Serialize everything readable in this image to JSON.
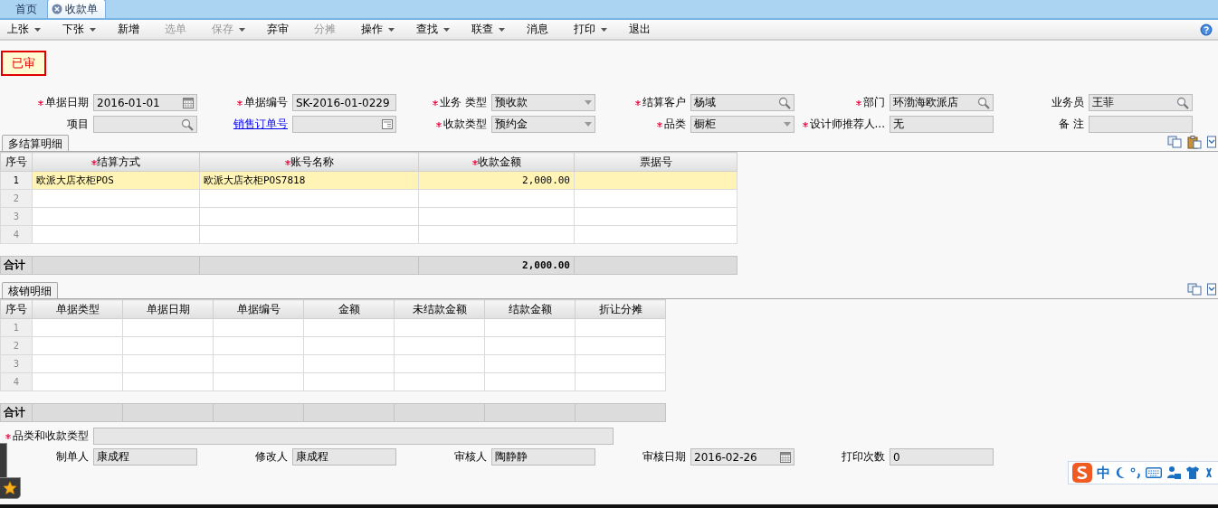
{
  "tabs": [
    {
      "label": "首页",
      "selected": false,
      "closable": false
    },
    {
      "label": "收款单",
      "selected": true,
      "closable": true
    }
  ],
  "toolbar": [
    {
      "label": "上张",
      "disabled": false,
      "dropdown": true
    },
    {
      "label": "下张",
      "disabled": false,
      "dropdown": true
    },
    {
      "label": "新增",
      "disabled": false,
      "dropdown": false
    },
    {
      "label": "选单",
      "disabled": true,
      "dropdown": false
    },
    {
      "label": "保存",
      "disabled": true,
      "dropdown": true
    },
    {
      "label": "弃审",
      "disabled": false,
      "dropdown": false
    },
    {
      "label": "分摊",
      "disabled": true,
      "dropdown": false
    },
    {
      "label": "操作",
      "disabled": false,
      "dropdown": true
    },
    {
      "label": "查找",
      "disabled": false,
      "dropdown": true
    },
    {
      "label": "联查",
      "disabled": false,
      "dropdown": true
    },
    {
      "label": "消息",
      "disabled": false,
      "dropdown": false
    },
    {
      "label": "打印",
      "disabled": false,
      "dropdown": true
    },
    {
      "label": "退出",
      "disabled": false,
      "dropdown": false
    }
  ],
  "status_stamp": "已审",
  "header_fields": [
    {
      "label": "单据日期",
      "required": true,
      "link": false,
      "kind": "date",
      "value": "2016-01-01"
    },
    {
      "label": "单据编号",
      "required": true,
      "link": false,
      "kind": "text",
      "value": "SK-2016-01-0229"
    },
    {
      "label": "业务 类型",
      "required": true,
      "link": false,
      "kind": "select",
      "value": "预收款"
    },
    {
      "label": "结算客户",
      "required": true,
      "link": false,
      "kind": "search",
      "value": "杨域"
    },
    {
      "label": "部门",
      "required": true,
      "link": false,
      "kind": "search",
      "value": "环渤海欧派店"
    },
    {
      "label": "业务员",
      "required": false,
      "link": false,
      "kind": "search",
      "value": "王菲"
    },
    {
      "label": "项目",
      "required": false,
      "link": false,
      "kind": "search"
    },
    {
      "label": "销售订单号",
      "required": false,
      "link": true,
      "kind": "picker"
    },
    {
      "label": "收款类型",
      "required": true,
      "link": false,
      "kind": "select",
      "value": "预约金"
    },
    {
      "label": "品类",
      "required": true,
      "link": false,
      "kind": "select",
      "value": "橱柜"
    },
    {
      "label": "设计师推荐人...",
      "required": true,
      "link": false,
      "kind": "text",
      "value": "无"
    },
    {
      "label": "备 注",
      "required": false,
      "link": false,
      "kind": "text"
    }
  ],
  "settlement": {
    "tab": "多结算明细",
    "columns": [
      {
        "label": "序号",
        "required": false
      },
      {
        "label": "结算方式",
        "required": true
      },
      {
        "label": "账号名称",
        "required": true
      },
      {
        "label": "收款金额",
        "required": true
      },
      {
        "label": "票据号",
        "required": false
      }
    ],
    "rows": [
      {
        "selected": true,
        "cells": [
          "1",
          "欧派大店衣柜POS",
          "欧派大店衣柜POS7818",
          "2,000.00"
        ]
      },
      {
        "selected": false,
        "cells": [
          "2"
        ]
      },
      {
        "selected": false,
        "cells": [
          "3"
        ]
      },
      {
        "selected": false,
        "cells": [
          "4"
        ]
      }
    ],
    "total": {
      "cells": [
        "合计",
        null,
        null,
        "2,000.00"
      ]
    }
  },
  "writeoff": {
    "tab": "核销明细",
    "columns": [
      {
        "label": "序号",
        "required": false
      },
      {
        "label": "单据类型",
        "required": false
      },
      {
        "label": "单据日期",
        "required": false
      },
      {
        "label": "单据编号",
        "required": false
      },
      {
        "label": "金额",
        "required": false
      },
      {
        "label": "未结款金额",
        "required": false
      },
      {
        "label": "结款金额",
        "required": false
      },
      {
        "label": "折让分摊",
        "required": false
      }
    ],
    "rows": [
      {
        "selected": false,
        "cells": [
          "1"
        ]
      },
      {
        "selected": false,
        "cells": [
          "2"
        ]
      },
      {
        "selected": false,
        "cells": [
          "3"
        ]
      },
      {
        "selected": false,
        "cells": [
          "4"
        ]
      }
    ],
    "total": {
      "cells": [
        "合计"
      ]
    }
  },
  "footer_wide_field": {
    "label": "品类和收款类型",
    "required": true,
    "link": false
  },
  "footer_fields": [
    {
      "label": "制单人",
      "required": false,
      "link": false,
      "kind": "text",
      "value": "康成程"
    },
    {
      "label": "修改人",
      "required": false,
      "link": false,
      "kind": "text",
      "value": "康成程"
    },
    {
      "label": "审核人",
      "required": false,
      "link": false,
      "kind": "text",
      "value": "陶静静"
    },
    {
      "label": "审核日期",
      "required": false,
      "link": false,
      "kind": "date",
      "value": "2016-02-26"
    },
    {
      "label": "打印次数",
      "required": false,
      "link": false,
      "kind": "text",
      "value": "0"
    }
  ],
  "ime_bar": {
    "mode": "中"
  }
}
